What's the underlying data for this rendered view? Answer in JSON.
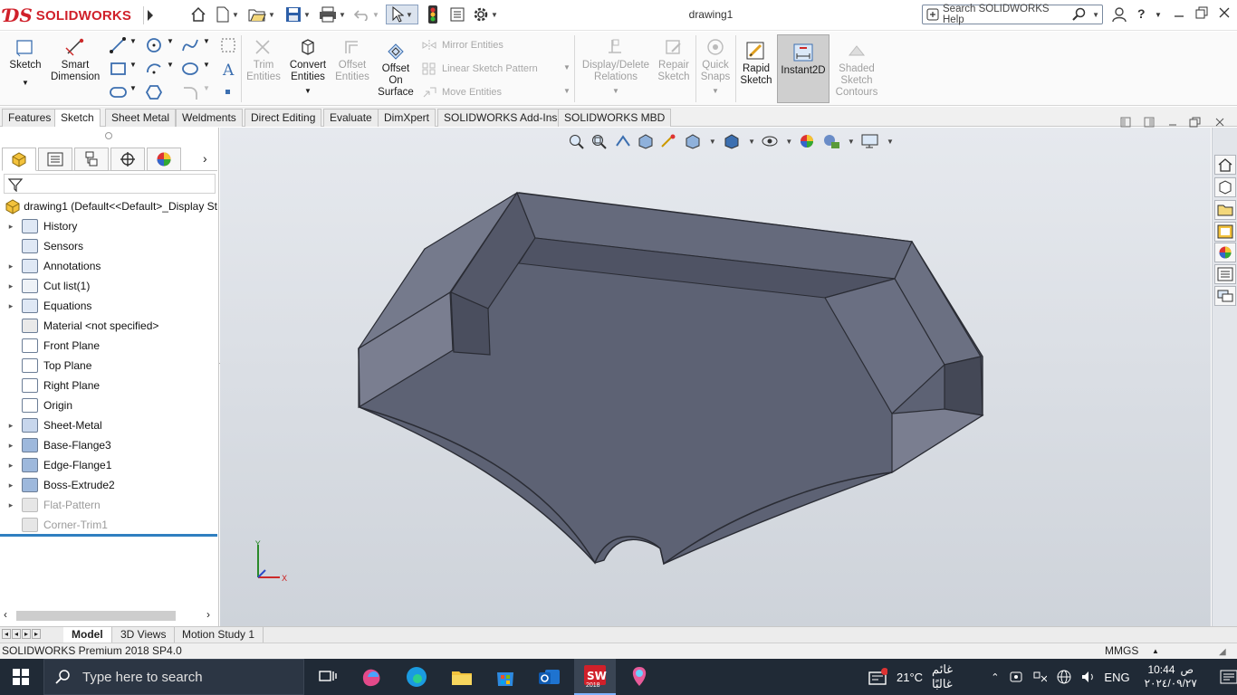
{
  "app": {
    "brand": "SOLIDWORKS",
    "document_title": "drawing1",
    "help_placeholder": "Search SOLIDWORKS Help"
  },
  "commands": {
    "sketch": "Sketch",
    "smart_dimension": "Smart Dimension",
    "trim_entities": "Trim Entities",
    "convert_entities": "Convert Entities",
    "offset_entities": "Offset Entities",
    "offset_on_surface": "Offset On Surface",
    "mirror_entities": "Mirror Entities",
    "linear_sketch_pattern": "Linear Sketch Pattern",
    "move_entities": "Move Entities",
    "display_delete_relations": "Display/Delete Relations",
    "repair_sketch": "Repair Sketch",
    "quick_snaps": "Quick Snaps",
    "rapid_sketch": "Rapid Sketch",
    "instant2d": "Instant2D",
    "shaded_sketch_contours": "Shaded Sketch Contours"
  },
  "tabs": [
    "Features",
    "Sketch",
    "Sheet Metal",
    "Weldments",
    "Direct Editing",
    "Evaluate",
    "DimXpert",
    "SOLIDWORKS Add-Ins",
    "SOLIDWORKS MBD"
  ],
  "active_tab": "Sketch",
  "tree": {
    "root": "drawing1  (Default<<Default>_Display St",
    "items": [
      {
        "label": "History",
        "icon": "history-folder-icon",
        "expandable": true,
        "dim": false
      },
      {
        "label": "Sensors",
        "icon": "sensors-icon",
        "expandable": false,
        "dim": false
      },
      {
        "label": "Annotations",
        "icon": "annotations-icon",
        "expandable": true,
        "dim": false
      },
      {
        "label": "Cut list(1)",
        "icon": "cut-list-icon",
        "expandable": true,
        "dim": false
      },
      {
        "label": "Equations",
        "icon": "equations-icon",
        "expandable": true,
        "dim": false
      },
      {
        "label": "Material <not specified>",
        "icon": "material-icon",
        "expandable": false,
        "dim": false
      },
      {
        "label": "Front Plane",
        "icon": "plane-icon",
        "expandable": false,
        "dim": false
      },
      {
        "label": "Top Plane",
        "icon": "plane-icon",
        "expandable": false,
        "dim": false
      },
      {
        "label": "Right Plane",
        "icon": "plane-icon",
        "expandable": false,
        "dim": false
      },
      {
        "label": "Origin",
        "icon": "origin-icon",
        "expandable": false,
        "dim": false
      },
      {
        "label": "Sheet-Metal",
        "icon": "sheet-metal-icon",
        "expandable": true,
        "dim": false
      },
      {
        "label": "Base-Flange3",
        "icon": "base-flange-icon",
        "expandable": true,
        "dim": false
      },
      {
        "label": "Edge-Flange1",
        "icon": "edge-flange-icon",
        "expandable": true,
        "dim": false
      },
      {
        "label": "Boss-Extrude2",
        "icon": "extrude-icon",
        "expandable": true,
        "dim": false
      },
      {
        "label": "Flat-Pattern",
        "icon": "flat-pattern-icon",
        "expandable": true,
        "dim": true
      },
      {
        "label": "Corner-Trim1",
        "icon": "corner-trim-icon",
        "expandable": false,
        "dim": true
      }
    ]
  },
  "bottom_tabs": [
    "Model",
    "3D Views",
    "Motion Study 1"
  ],
  "active_bottom_tab": "Model",
  "status": {
    "left": "SOLIDWORKS Premium 2018 SP4.0",
    "units": "MMGS"
  },
  "taskbar": {
    "search_placeholder": "Type here to search",
    "temperature": "21°C",
    "weather": "غائم غالبًا",
    "language": "ENG",
    "time": "10:44",
    "ampm": "ص",
    "date": "٢٠٢٤/٠٩/٢٧",
    "sw_badge": "2018"
  },
  "colors": {
    "accent": "#d0202a",
    "part_face": "#5b6072",
    "viewport_top": "#e6e9ee",
    "viewport_bottom": "#ced3da",
    "taskbar": "#202a36"
  }
}
